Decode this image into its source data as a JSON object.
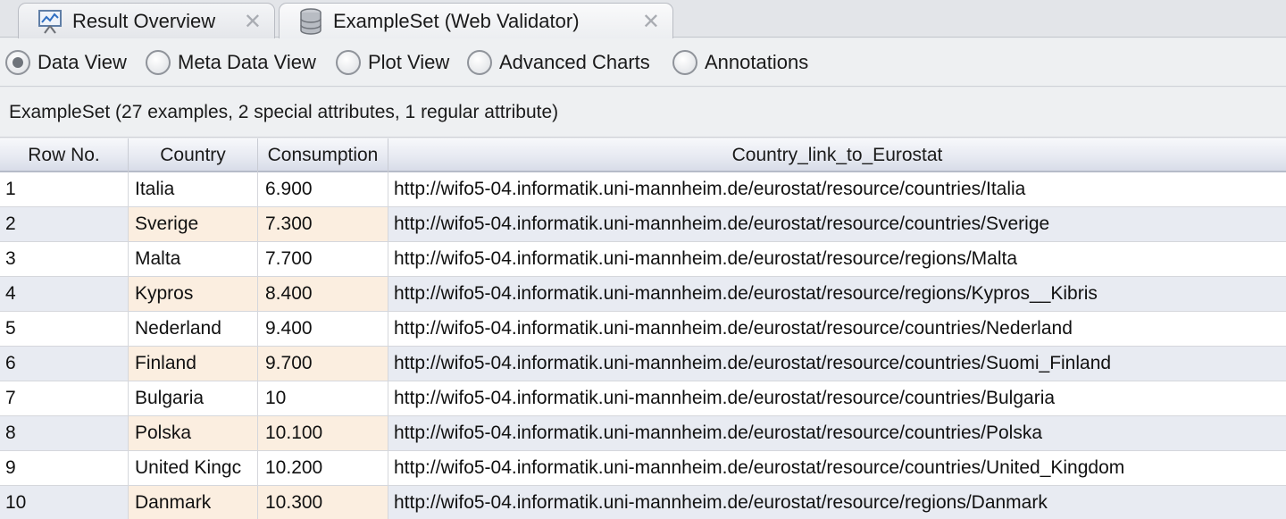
{
  "tabs": [
    {
      "label": "Result Overview",
      "icon": "result-overview-icon",
      "close": "✕"
    },
    {
      "label": "ExampleSet (Web Validator)",
      "icon": "database-icon",
      "close": "✕"
    }
  ],
  "views": [
    {
      "label": "Data View",
      "selected": true
    },
    {
      "label": "Meta Data View",
      "selected": false
    },
    {
      "label": "Plot View",
      "selected": false
    },
    {
      "label": "Advanced Charts",
      "selected": false
    },
    {
      "label": "Annotations",
      "selected": false
    }
  ],
  "info": "ExampleSet (27 examples, 2 special attributes, 1 regular attribute)",
  "table": {
    "columns": [
      "Row No.",
      "Country",
      "Consumption",
      "Country_link_to_Eurostat"
    ],
    "rows": [
      [
        "1",
        "Italia",
        "6.900",
        "http://wifo5-04.informatik.uni-mannheim.de/eurostat/resource/countries/Italia"
      ],
      [
        "2",
        "Sverige",
        "7.300",
        "http://wifo5-04.informatik.uni-mannheim.de/eurostat/resource/countries/Sverige"
      ],
      [
        "3",
        "Malta",
        "7.700",
        "http://wifo5-04.informatik.uni-mannheim.de/eurostat/resource/regions/Malta"
      ],
      [
        "4",
        "Kypros",
        "8.400",
        "http://wifo5-04.informatik.uni-mannheim.de/eurostat/resource/regions/Kypros__Kibris"
      ],
      [
        "5",
        "Nederland",
        "9.400",
        "http://wifo5-04.informatik.uni-mannheim.de/eurostat/resource/countries/Nederland"
      ],
      [
        "6",
        "Finland",
        "9.700",
        "http://wifo5-04.informatik.uni-mannheim.de/eurostat/resource/countries/Suomi_Finland"
      ],
      [
        "7",
        "Bulgaria",
        "10",
        "http://wifo5-04.informatik.uni-mannheim.de/eurostat/resource/countries/Bulgaria"
      ],
      [
        "8",
        "Polska",
        "10.100",
        "http://wifo5-04.informatik.uni-mannheim.de/eurostat/resource/countries/Polska"
      ],
      [
        "9",
        "United Kingc",
        "10.200",
        "http://wifo5-04.informatik.uni-mannheim.de/eurostat/resource/countries/United_Kingdom"
      ],
      [
        "10",
        "Danmark",
        "10.300",
        "http://wifo5-04.informatik.uni-mannheim.de/eurostat/resource/regions/Danmark"
      ]
    ]
  },
  "colors": {
    "even_row_tint": "#e8ebf2",
    "highlight_column_tint": "#fbeee0",
    "header_bottom": "#d8dce8"
  }
}
